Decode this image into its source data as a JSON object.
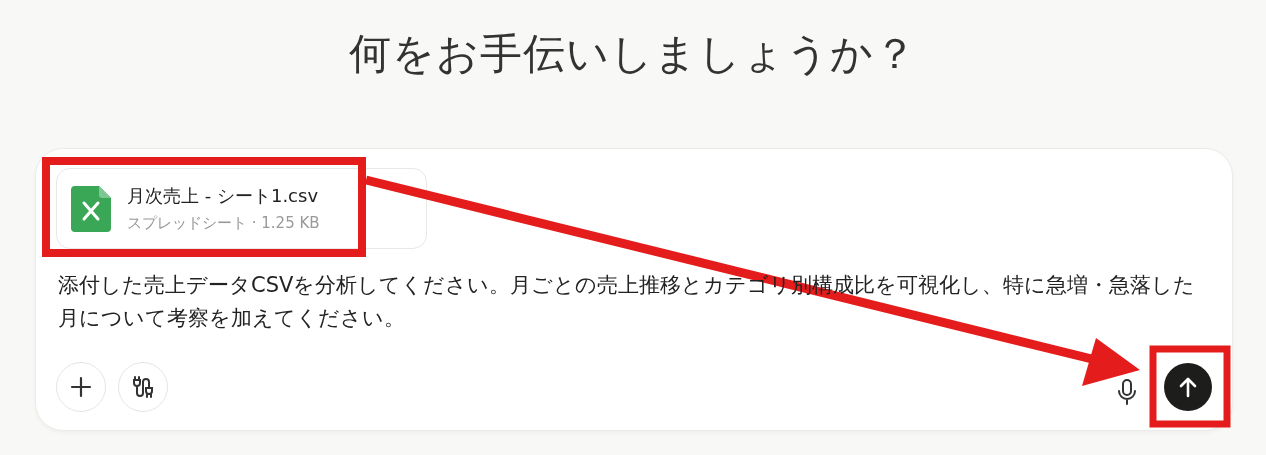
{
  "heading": "何をお手伝いしましょうか？",
  "composer": {
    "attachment": {
      "name": "月次売上 - シート1.csv",
      "meta": "スプレッドシート · 1.25 KB"
    },
    "message": "添付した売上データCSVを分析してください。月ごとの売上推移とカテゴリ別構成比を可視化し、特に急増・急落した月について考察を加えてください。"
  }
}
